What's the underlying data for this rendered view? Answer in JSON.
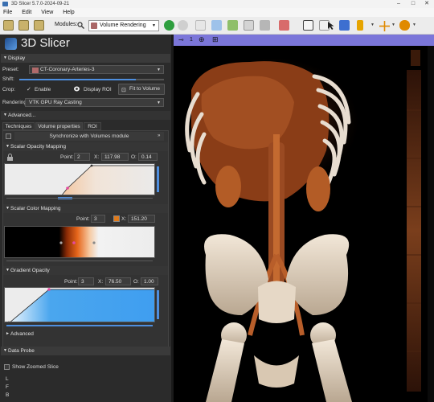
{
  "window": {
    "title": "3D Slicer 5.7.0-2024-09-21",
    "controls": [
      "–",
      "□",
      "✕"
    ]
  },
  "menu": [
    "File",
    "Edit",
    "View",
    "Help"
  ],
  "toolbar": {
    "modules_label": "Modules:",
    "module_selected": "Volume Rendering",
    "icons": [
      "load-data-icon",
      "add-data-icon",
      "save-icon",
      "search-icon",
      "back-icon",
      "forward-icon",
      "data-module-icon",
      "models-icon",
      "volumes-icon",
      "segment-icon",
      "markups-icon",
      "layout-icon",
      "view-icon",
      "pointer-icon",
      "place-icon",
      "crosshair-icon",
      "extension-icon"
    ]
  },
  "app": {
    "logo_text": "3D Slicer"
  },
  "display": {
    "header": "Display",
    "preset_label": "Preset:",
    "preset_value": "CT-Coronary-Arteries-3",
    "shift_label": "Shift:",
    "crop_label": "Crop:",
    "enable_label": "Enable",
    "display_roi_label": "Display ROI",
    "fit_button": "Fit to Volume",
    "rendering_label": "Rendering:",
    "rendering_value": "VTK GPU Ray Casting",
    "crop_enabled": true,
    "roi_shown": true
  },
  "advanced": {
    "header": "Advanced...",
    "tabs": [
      "Techniques",
      "Volume properties",
      "ROI"
    ],
    "active_tab": "Volume properties",
    "sync_label": "Synchronize with Volumes module"
  },
  "scalar_opacity": {
    "header": "Scalar Opacity Mapping",
    "point_label": "Point:",
    "point": "2",
    "x_label": "X:",
    "x": "117.98",
    "o_label": "O:",
    "o": "0.14"
  },
  "scalar_color": {
    "header": "Scalar Color Mapping",
    "point_label": "Point:",
    "point": "3",
    "x_label": "X:",
    "x": "151.20",
    "swatch_color": "#e07a1a"
  },
  "gradient_opacity": {
    "header": "Gradient Opacity",
    "point_label": "Point:",
    "point": "3",
    "x_label": "X:",
    "x": "76.50",
    "o_label": "O:",
    "o": "1.00"
  },
  "advanced_footer": "Advanced",
  "data_probe": {
    "header": "Data Probe",
    "zoom_label": "Show Zoomed Slice",
    "coords": [
      "L",
      "F",
      "B"
    ]
  },
  "view": {
    "controls": [
      "pin-icon",
      "view-number-icon",
      "center-icon",
      "maximize-icon"
    ],
    "view_number": "1"
  },
  "colors": {
    "accent_view": "#7b76d9",
    "panel_bg": "#2b2b2b",
    "highlight": "#e4499f"
  }
}
